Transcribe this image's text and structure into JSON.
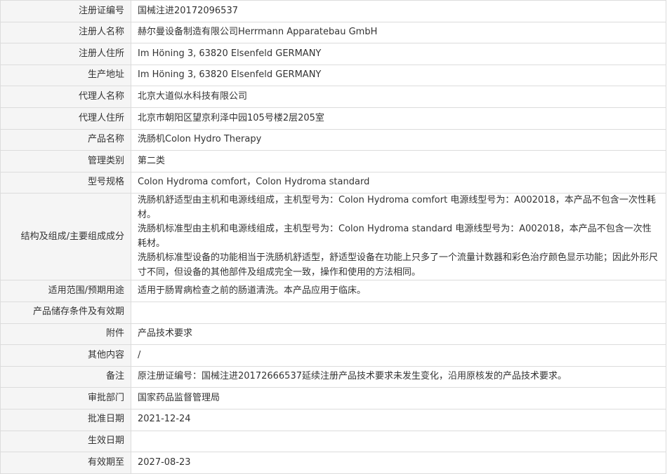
{
  "rows": [
    {
      "label": "注册证编号",
      "value": "国械注进20172096537"
    },
    {
      "label": "注册人名称",
      "value": "赫尔曼设备制造有限公司Herrmann Apparatebau GmbH"
    },
    {
      "label": "注册人住所",
      "value": "Im Höning 3, 63820 Elsenfeld GERMANY"
    },
    {
      "label": "生产地址",
      "value": "Im Höning 3, 63820 Elsenfeld GERMANY"
    },
    {
      "label": "代理人名称",
      "value": "北京大道似水科技有限公司"
    },
    {
      "label": "代理人住所",
      "value": "北京市朝阳区望京利泽中园105号楼2层205室"
    },
    {
      "label": "产品名称",
      "value": "洗肠机Colon Hydro Therapy"
    },
    {
      "label": "管理类别",
      "value": "第二类"
    },
    {
      "label": "型号规格",
      "value": "Colon Hydroma comfort，Colon Hydroma standard"
    },
    {
      "label": "结构及组成/主要组成成分",
      "lines": [
        "洗肠机舒适型由主机和电源线组成，主机型号为：Colon Hydroma comfort 电源线型号为：A002018，本产品不包含一次性耗材。",
        "洗肠机标准型由主机和电源线组成，主机型号为：Colon Hydroma standard 电源线型号为：A002018，本产品不包含一次性耗材。",
        "洗肠机标准型设备的功能相当于洗肠机舒适型，舒适型设备在功能上只多了一个流量计数器和彩色治疗颜色显示功能；因此外形尺寸不同，但设备的其他部件及组成完全一致，操作和使用的方法相同。"
      ]
    },
    {
      "label": "适用范围/预期用途",
      "value": "适用于肠胃病检查之前的肠道清洗。本产品应用于临床。"
    },
    {
      "label": "产品储存条件及有效期",
      "value": ""
    },
    {
      "label": "附件",
      "value": "产品技术要求"
    },
    {
      "label": "其他内容",
      "value": "/"
    },
    {
      "label": "备注",
      "value": "原注册证编号：国械注进20172666537延续注册产品技术要求未发生变化，沿用原核发的产品技术要求。"
    },
    {
      "label": "审批部门",
      "value": "国家药品监督管理局"
    },
    {
      "label": "批准日期",
      "value": "2021-12-24"
    },
    {
      "label": "生效日期",
      "value": ""
    },
    {
      "label": "有效期至",
      "value": "2027-08-23"
    }
  ]
}
